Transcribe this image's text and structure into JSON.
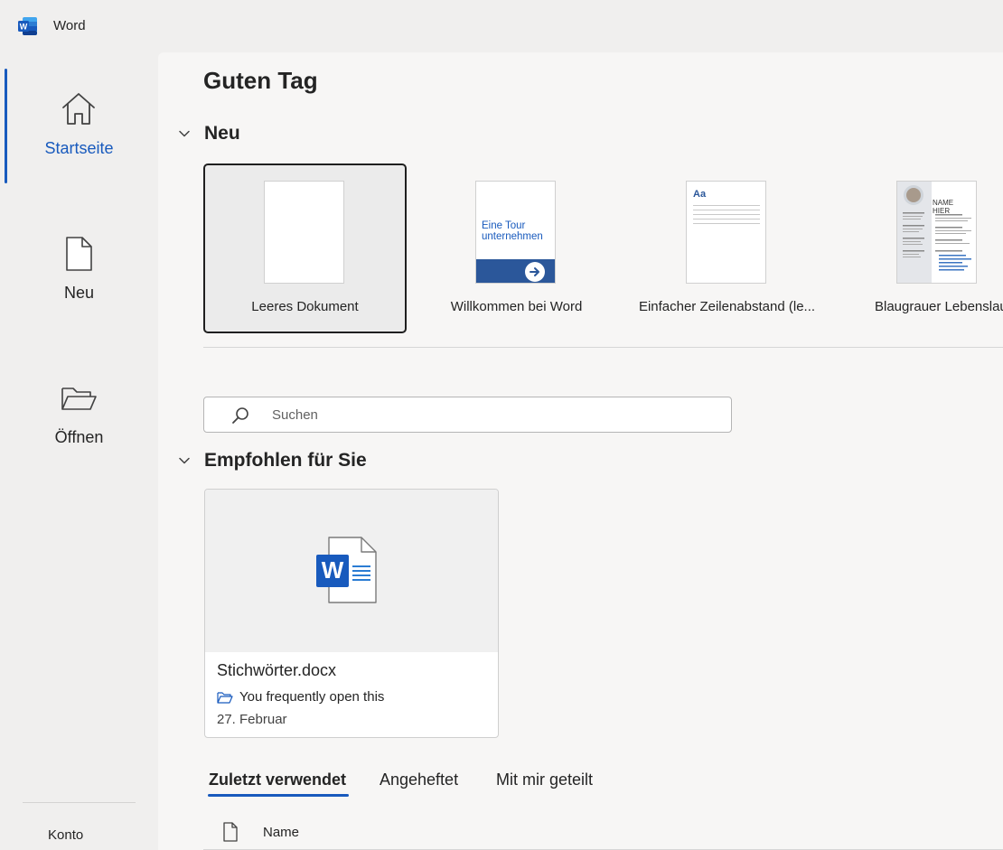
{
  "app": {
    "title": "Word",
    "icon": "word-app-icon",
    "brand_color": "#185abd"
  },
  "sidebar": {
    "items": [
      {
        "label": "Startseite",
        "icon": "home-icon",
        "active": true
      },
      {
        "label": "Neu",
        "icon": "new-document-icon",
        "active": false
      },
      {
        "label": "Öffnen",
        "icon": "folder-open-icon",
        "active": false
      }
    ],
    "account": "Konto"
  },
  "main": {
    "greeting": "Guten Tag",
    "new_section": {
      "title": "Neu",
      "templates": [
        {
          "label": "Leeres Dokument",
          "selected": true
        },
        {
          "label": "Willkommen bei Word",
          "thumb_text": "Eine Tour unternehmen"
        },
        {
          "label": "Einfacher Zeilenabstand (le...",
          "thumb_text": "Aa"
        },
        {
          "label": "Blaugrauer Lebenslauf",
          "thumb_text": "NAME HIER"
        }
      ]
    },
    "search": {
      "placeholder": "Suchen",
      "icon": "search-icon"
    },
    "recommended": {
      "title": "Empfohlen für Sie",
      "cards": [
        {
          "file_name": "Stichwörter.docx",
          "reason": "You frequently open this",
          "date": "27. Februar",
          "icon": "word-document-icon"
        }
      ]
    },
    "tabs": [
      {
        "label": "Zuletzt verwendet",
        "active": true
      },
      {
        "label": "Angeheftet",
        "active": false
      },
      {
        "label": "Mit mir geteilt",
        "active": false
      }
    ],
    "file_list": {
      "columns": [
        "Name"
      ]
    }
  }
}
